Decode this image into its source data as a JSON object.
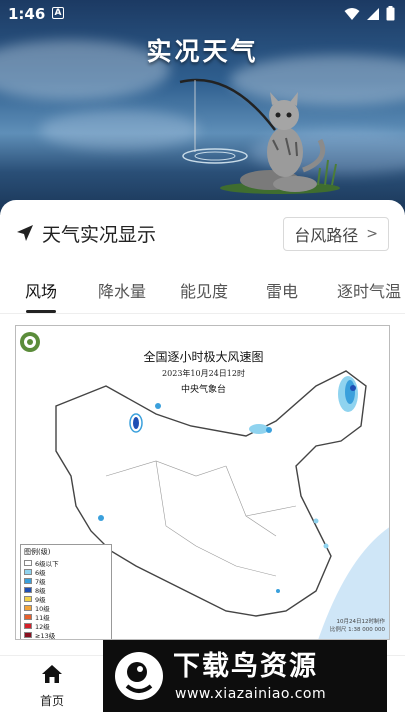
{
  "status_bar": {
    "time": "1:46",
    "badge": "A"
  },
  "banner": {
    "title": "实况天气"
  },
  "section": {
    "title": "天气实况显示",
    "typhoon_button": "台风路径",
    "chevron": ">"
  },
  "tabs": [
    {
      "label": "风场",
      "active": true
    },
    {
      "label": "降水量",
      "active": false
    },
    {
      "label": "能见度",
      "active": false
    },
    {
      "label": "雷电",
      "active": false
    },
    {
      "label": "逐时气温",
      "active": false
    }
  ],
  "map": {
    "title": "全国逐小时极大风速图",
    "date": "2023年10月24日12时",
    "org": "中央气象台",
    "legend_title": "图例(级)",
    "legend": [
      {
        "label": "6级以下",
        "color": "#ffffff"
      },
      {
        "label": "6级",
        "color": "#8fd3ef"
      },
      {
        "label": "7级",
        "color": "#3aa0dc"
      },
      {
        "label": "8级",
        "color": "#1f4fb5"
      },
      {
        "label": "9级",
        "color": "#f3d24a"
      },
      {
        "label": "10级",
        "color": "#f2a33a"
      },
      {
        "label": "11级",
        "color": "#e8602c"
      },
      {
        "label": "12级",
        "color": "#d4202a"
      },
      {
        "label": "≥13级",
        "color": "#8a1020"
      }
    ],
    "footnote": "10月24日12时制作",
    "scale_text": "比例尺 1:38 000 000"
  },
  "bottom_nav": {
    "home_label": "首页"
  },
  "watermark": {
    "text": "下载鸟资源",
    "url": "www.xiazainiao.com"
  }
}
